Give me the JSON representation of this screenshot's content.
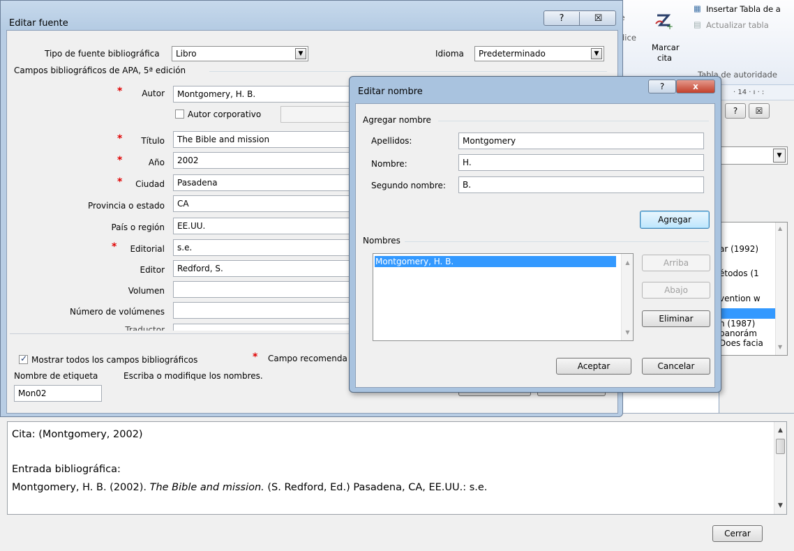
{
  "ribbon": {
    "insert_table_label": "Insertar Tabla de a",
    "update_table_label": "Actualizar tabla",
    "mark_citation_line1": "Marcar",
    "mark_citation_line2": "cita",
    "group_label": "Tabla de autoridade",
    "partial_left_1": "te",
    "partial_left_2": "dice"
  },
  "behind_dialog": {
    "ruler_text": "· 14 · ı · :",
    "help_button": "?",
    "close_button": "☒",
    "list_items": [
      "ar (1992)",
      "étodos (1",
      "vention w",
      "h  (1987)",
      "panorám",
      "Does facia"
    ]
  },
  "main_dialog": {
    "title": "Editar fuente",
    "help_button": "?",
    "close_button": "☒",
    "source_type_label": "Tipo de fuente bibliográfica",
    "source_type_value": "Libro",
    "language_label": "Idioma",
    "language_value": "Predeterminado",
    "group_title": "Campos bibliográficos de APA, 5ª edición",
    "fields": {
      "author_label": "Autor",
      "author_value": "Montgomery, H. B.",
      "corporate_author_label": "Autor corporativo",
      "title_label": "Título",
      "title_value": "The Bible and mission",
      "year_label": "Año",
      "year_value": "2002",
      "city_label": "Ciudad",
      "city_value": "Pasadena",
      "state_label": "Provincia o estado",
      "state_value": "CA",
      "country_label": "País o región",
      "country_value": "EE.UU.",
      "publisher_label": "Editorial",
      "publisher_value": "s.e.",
      "editor_label": "Editor",
      "editor_value": "Redford, S.",
      "volume_label": "Volumen",
      "volume_value": "",
      "num_volumes_label": "Número de volúmenes",
      "num_volumes_value": "",
      "translator_label": "Traductor"
    },
    "show_all_label": "Mostrar todos los campos bibliográficos",
    "recommended_label": "Campo recomenda",
    "tag_name_label": "Nombre de etiqueta",
    "tag_hint": "Escriba o modifique los nombres.",
    "tag_value": "Mon02"
  },
  "name_dialog": {
    "title": "Editar nombre",
    "help_button": "?",
    "close_button": "x",
    "add_group_title": "Agregar nombre",
    "last_name_label": "Apellidos:",
    "last_name_value": "Montgomery",
    "first_name_label": "Nombre:",
    "first_name_value": "H.",
    "middle_name_label": "Segundo nombre:",
    "middle_name_value": "B.",
    "add_button": "Agregar",
    "names_group_title": "Nombres",
    "names": [
      "Montgomery, H. B."
    ],
    "up_button": "Arriba",
    "down_button": "Abajo",
    "delete_button": "Eliminar",
    "ok_button": "Aceptar",
    "cancel_button": "Cancelar"
  },
  "preview": {
    "citation": "Cita:  (Montgomery, 2002)",
    "bib_heading": "Entrada bibliográfica:",
    "bib_author_year": "Montgomery, H. B. (2002).",
    "bib_title": "The Bible and mission.",
    "bib_rest": "(S. Redford, Ed.) Pasadena, CA, EE.UU.: s.e."
  },
  "close_button": "Cerrar"
}
